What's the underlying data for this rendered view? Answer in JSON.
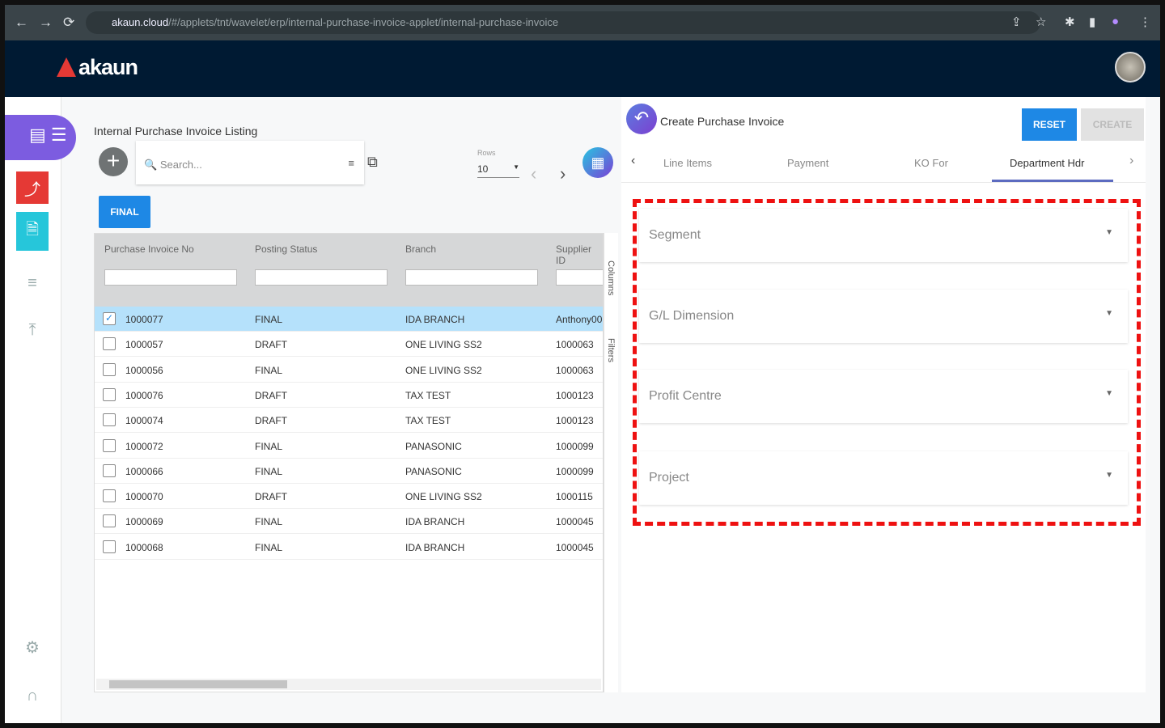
{
  "browser": {
    "url_host": "akaun.cloud",
    "url_path": "/#/applets/tnt/wavelet/erp/internal-purchase-invoice-applet/internal-purchase-invoice"
  },
  "app": {
    "logo": "akaun"
  },
  "listing": {
    "title": "Internal Purchase Invoice Listing",
    "search_placeholder": "Search...",
    "rows_label": "Rows",
    "rows_value": "10",
    "final_button": "FINAL",
    "columns": [
      "Purchase Invoice No",
      "Posting Status",
      "Branch",
      "Supplier ID"
    ],
    "side_tabs": [
      "Columns",
      "Filters"
    ],
    "rows": [
      {
        "no": "1000077",
        "status": "FINAL",
        "branch": "IDA BRANCH",
        "supplier": "Anthony00",
        "selected": true
      },
      {
        "no": "1000057",
        "status": "DRAFT",
        "branch": "ONE LIVING SS2",
        "supplier": "1000063",
        "selected": false
      },
      {
        "no": "1000056",
        "status": "FINAL",
        "branch": "ONE LIVING SS2",
        "supplier": "1000063",
        "selected": false
      },
      {
        "no": "1000076",
        "status": "DRAFT",
        "branch": "TAX TEST",
        "supplier": "1000123",
        "selected": false
      },
      {
        "no": "1000074",
        "status": "DRAFT",
        "branch": "TAX TEST",
        "supplier": "1000123",
        "selected": false
      },
      {
        "no": "1000072",
        "status": "FINAL",
        "branch": "PANASONIC",
        "supplier": "1000099",
        "selected": false
      },
      {
        "no": "1000066",
        "status": "FINAL",
        "branch": "PANASONIC",
        "supplier": "1000099",
        "selected": false
      },
      {
        "no": "1000070",
        "status": "DRAFT",
        "branch": "ONE LIVING SS2",
        "supplier": "1000115",
        "selected": false
      },
      {
        "no": "1000069",
        "status": "FINAL",
        "branch": "IDA BRANCH",
        "supplier": "1000045",
        "selected": false
      },
      {
        "no": "1000068",
        "status": "FINAL",
        "branch": "IDA BRANCH",
        "supplier": "1000045",
        "selected": false
      }
    ]
  },
  "form": {
    "title": "Create Purchase Invoice",
    "reset": "RESET",
    "create": "CREATE",
    "tabs": [
      "Line Items",
      "Payment",
      "KO For",
      "Department Hdr"
    ],
    "active_tab": "Department Hdr",
    "fields": [
      "Segment",
      "G/L Dimension",
      "Profit Centre",
      "Project"
    ]
  },
  "colors": {
    "primary": "#1e88e5",
    "header": "#001a33",
    "highlight": "#ee1111"
  }
}
